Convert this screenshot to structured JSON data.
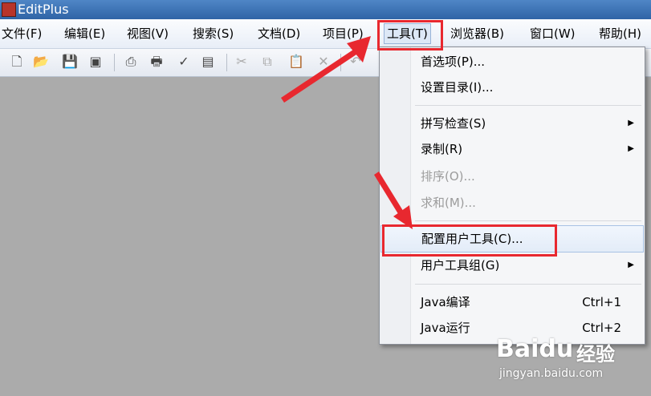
{
  "window": {
    "title": "EditPlus"
  },
  "menubar": {
    "items": [
      {
        "label": "文件(F)"
      },
      {
        "label": "编辑(E)"
      },
      {
        "label": "视图(V)"
      },
      {
        "label": "搜索(S)"
      },
      {
        "label": "文档(D)"
      },
      {
        "label": "项目(P)"
      },
      {
        "label": "工具(T)"
      },
      {
        "label": "浏览器(B)"
      },
      {
        "label": "窗口(W)"
      },
      {
        "label": "帮助(H)"
      }
    ]
  },
  "toolbar": {
    "icons": [
      "new-file-icon",
      "open-folder-icon",
      "save-icon",
      "save-all-icon",
      "print-preview-icon",
      "print-icon",
      "spell-check-icon",
      "html-toolbar-icon",
      "cut-icon",
      "copy-icon",
      "paste-icon",
      "delete-icon",
      "undo-icon"
    ]
  },
  "tools_menu": {
    "items": [
      {
        "label": "首选项(P)..."
      },
      {
        "label": "设置目录(I)..."
      },
      {
        "label": "拼写检查(S)",
        "submenu": true
      },
      {
        "label": "录制(R)",
        "submenu": true
      },
      {
        "label": "排序(O)...",
        "disabled": true
      },
      {
        "label": "求和(M)...",
        "disabled": true
      },
      {
        "label": "配置用户工具(C)..."
      },
      {
        "label": "用户工具组(G)",
        "submenu": true
      },
      {
        "label": "Java编译",
        "shortcut": "Ctrl+1"
      },
      {
        "label": "Java运行",
        "shortcut": "Ctrl+2"
      }
    ],
    "submenu_arrow": "▶"
  },
  "watermark": {
    "brand": "Baidu",
    "brand_cn": "经验",
    "url": "jingyan.baidu.com"
  },
  "annotation_color": "#e8282f"
}
